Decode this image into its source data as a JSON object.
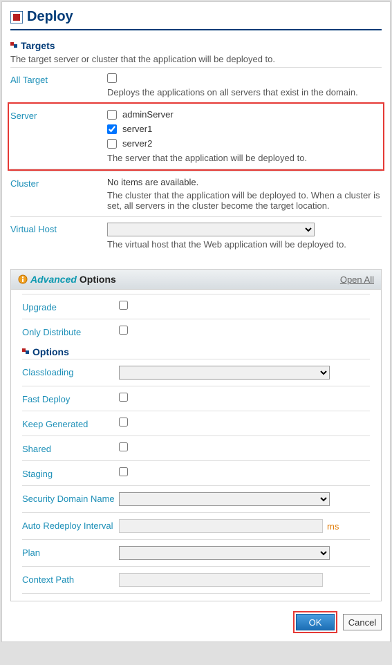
{
  "page_title": "Deploy",
  "targets_section": {
    "heading": "Targets",
    "description": "The target server or cluster that the application will be deployed to.",
    "rows": {
      "all_target": {
        "label": "All Target",
        "help": "Deploys the applications on all servers that exist in the domain.",
        "checked": false
      },
      "server": {
        "label": "Server",
        "items": [
          {
            "label": "adminServer",
            "checked": false
          },
          {
            "label": "server1",
            "checked": true
          },
          {
            "label": "server2",
            "checked": false
          }
        ],
        "help": "The server that the application will be deployed to."
      },
      "cluster": {
        "label": "Cluster",
        "empty_text": "No items are available.",
        "help": "The cluster that the application will be deployed to. When a cluster is set, all servers in the cluster become the target location."
      },
      "virtual_host": {
        "label": "Virtual Host",
        "help": "The virtual host that the Web application will be deployed to."
      }
    }
  },
  "advanced": {
    "title_italic": "Advanced",
    "title_rest": "Options",
    "open_all": "Open All",
    "rows": {
      "upgrade": {
        "label": "Upgrade",
        "checked": false
      },
      "only_distribute": {
        "label": "Only Distribute",
        "checked": false
      }
    },
    "options_heading": "Options",
    "option_rows": {
      "classloading": {
        "label": "Classloading"
      },
      "fast_deploy": {
        "label": "Fast Deploy",
        "checked": false
      },
      "keep_generated": {
        "label": "Keep Generated",
        "checked": false
      },
      "shared": {
        "label": "Shared",
        "checked": false
      },
      "staging": {
        "label": "Staging",
        "checked": false
      },
      "security_domain": {
        "label": "Security Domain Name"
      },
      "auto_redeploy": {
        "label": "Auto Redeploy Interval",
        "unit": "ms",
        "value": ""
      },
      "plan": {
        "label": "Plan"
      },
      "context_path": {
        "label": "Context Path",
        "value": ""
      }
    }
  },
  "buttons": {
    "ok": "OK",
    "cancel": "Cancel"
  }
}
